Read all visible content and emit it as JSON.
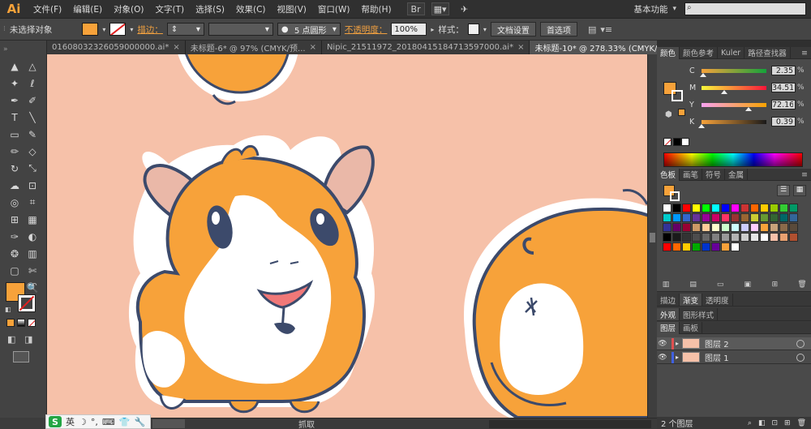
{
  "app": {
    "logo": "Ai",
    "menu": [
      "文件(F)",
      "编辑(E)",
      "对象(O)",
      "文字(T)",
      "选择(S)",
      "效果(C)",
      "视图(V)",
      "窗口(W)",
      "帮助(H)"
    ],
    "workspace": "基本功能",
    "search_placeholder": ""
  },
  "control_bar": {
    "selection_label": "未选择对象",
    "fill_color": "#f7a23a",
    "stroke_label": "描边：",
    "brush_label": "5 点圆形",
    "opacity_label": "不透明度：",
    "opacity_value": "100%",
    "style_label": "样式：",
    "doc_setup_button": "文档设置",
    "preferences_button": "首选项"
  },
  "tabs": [
    {
      "label": "01608032326059000000.ai*",
      "active": false
    },
    {
      "label": "未标题-6* @ 97% (CMYK/预...",
      "active": false
    },
    {
      "label": "Nipic_21511972_20180415184713597000.ai*",
      "active": false
    },
    {
      "label": "未标题-10* @ 278.33% (CMYK/预览)",
      "active": true
    }
  ],
  "toolbox": {
    "tools": [
      "selection-tool",
      "direct-selection-tool",
      "magic-wand-tool",
      "lasso-tool",
      "pen-tool",
      "curvature-tool",
      "type-tool",
      "line-tool",
      "rectangle-tool",
      "paintbrush-tool",
      "pencil-tool",
      "eraser-tool",
      "rotate-tool",
      "scale-tool",
      "warp-tool",
      "free-transform-tool",
      "shape-builder-tool",
      "perspective-tool",
      "mesh-tool",
      "gradient-tool",
      "eyedropper-tool",
      "blend-tool",
      "symbol-sprayer-tool",
      "column-graph-tool",
      "artboard-tool",
      "slice-tool",
      "hand-tool",
      "zoom-tool"
    ],
    "tool_glyphs": [
      "▲",
      "△",
      "✦",
      "ℓ",
      "✒",
      "✐",
      "T",
      "╲",
      "▭",
      "✎",
      "✏",
      "◇",
      "↻",
      "⤡",
      "☁",
      "⊡",
      "◎",
      "⌗",
      "⊞",
      "▦",
      "✑",
      "◐",
      "❂",
      "▥",
      "▢",
      "✄",
      "✋",
      "🔍"
    ],
    "fill_color": "#f7a23a",
    "stroke_color": "none"
  },
  "status_bar": {
    "status_text": "抓取"
  },
  "ime": {
    "lang": "英",
    "items": [
      "☽",
      "°,",
      "⌨",
      "👕",
      "🔧"
    ]
  },
  "color_panel": {
    "tabs": [
      "颜色",
      "颜色参考",
      "Kuler",
      "路径查找器"
    ],
    "channels": [
      {
        "label": "C",
        "value": "2.35",
        "fraction": 0.0235,
        "gradient": [
          "#f7a23a",
          "#14a23a"
        ]
      },
      {
        "label": "M",
        "value": "34.51",
        "fraction": 0.3451,
        "gradient": [
          "#f7f83a",
          "#f7153a"
        ]
      },
      {
        "label": "Y",
        "value": "72.16",
        "fraction": 0.7216,
        "gradient": [
          "#f7a2f0",
          "#f7a200"
        ]
      },
      {
        "label": "K",
        "value": "0.39",
        "fraction": 0.0039,
        "gradient": [
          "#f7a23a",
          "#1a1a1a"
        ]
      }
    ],
    "percent_sign": "%"
  },
  "swatches_panel": {
    "tabs": [
      "色板",
      "画笔",
      "符号",
      "金属"
    ],
    "rows": [
      [
        "#ffffff",
        "#000000",
        "#ff0000",
        "#ffff00",
        "#00ff00",
        "#00ffff",
        "#0000ff",
        "#ff00ff",
        "#cc3333",
        "#ff6600",
        "#ffcc00",
        "#99cc00",
        "#33cc33",
        "#009966"
      ],
      [
        "#00cccc",
        "#0099ff",
        "#3366cc",
        "#663399",
        "#990099",
        "#cc0066",
        "#ff3366",
        "#993333",
        "#996633",
        "#cccc33",
        "#669933",
        "#336633",
        "#006666",
        "#336699"
      ],
      [
        "#333399",
        "#660066",
        "#990033",
        "#cc9966",
        "#ffcc99",
        "#ffffcc",
        "#ccffcc",
        "#ccffff",
        "#ccccff",
        "#ffccff",
        "#f7a23a",
        "#c8a27a",
        "#8a6a4a",
        "#5a4a3a"
      ],
      [
        "#000000",
        "#1a1a1a",
        "#333333",
        "#4d4d4d",
        "#666666",
        "#808080",
        "#999999",
        "#b3b3b3",
        "#cccccc",
        "#e6e6e6",
        "#ffffff",
        "#f7c1a9",
        "#e8a070",
        "#b05030"
      ],
      [
        "#ff0000",
        "#ff6600",
        "#ffcc00",
        "#00aa00",
        "#0033cc",
        "#660099",
        "#f7a23a",
        "#ffffff"
      ]
    ]
  },
  "stroke_gradient_panel": {
    "tabs": [
      "描边",
      "渐变",
      "透明度"
    ]
  },
  "appearance_panel": {
    "tabs": [
      "外观",
      "图形样式"
    ]
  },
  "layers_panel": {
    "tabs": [
      "图层",
      "画板"
    ],
    "layers": [
      {
        "name": "图层 2",
        "color": "#e05050"
      },
      {
        "name": "图层 1",
        "color": "#4060e0"
      }
    ],
    "count_label": "2 个图层"
  },
  "canvas": {
    "background": "#f6c1a9",
    "outline_color": "#3c4a6b",
    "orange": "#f7a23a",
    "ear_pink": "#eab8a8",
    "nose_pink": "#f07878"
  }
}
